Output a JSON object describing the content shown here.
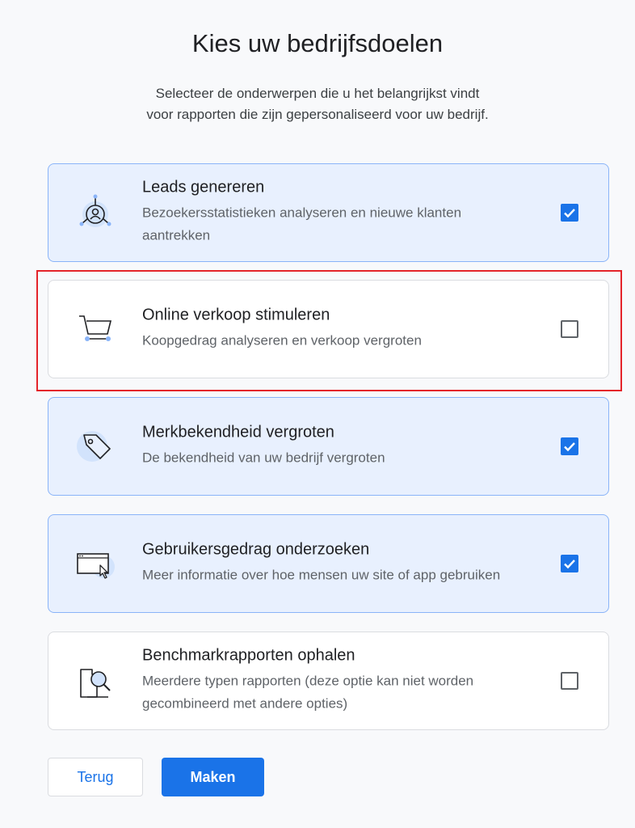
{
  "header": {
    "title": "Kies uw bedrijfsdoelen",
    "subtitle_line1": "Selecteer de onderwerpen die u het belangrijkst vindt",
    "subtitle_line2": "voor rapporten die zijn gepersonaliseerd voor uw bedrijf."
  },
  "options": [
    {
      "title": "Leads genereren",
      "description": "Bezoekersstatistieken analyseren en nieuwe klanten aantrekken",
      "checked": true,
      "icon": "person-network-icon"
    },
    {
      "title": "Online verkoop stimuleren",
      "description": "Koopgedrag analyseren en verkoop vergroten",
      "checked": false,
      "icon": "shopping-cart-icon"
    },
    {
      "title": "Merkbekendheid vergroten",
      "description": "De bekendheid van uw bedrijf vergroten",
      "checked": true,
      "icon": "tag-icon"
    },
    {
      "title": "Gebruikersgedrag onderzoeken",
      "description": "Meer informatie over hoe mensen uw site of app gebruiken",
      "checked": true,
      "icon": "browser-cursor-icon"
    },
    {
      "title": "Benchmarkrapporten ophalen",
      "description": "Meerdere typen rapporten (deze optie kan niet worden gecombineerd met andere opties)",
      "checked": false,
      "icon": "report-magnifier-icon"
    }
  ],
  "buttons": {
    "back_label": "Terug",
    "create_label": "Maken"
  },
  "colors": {
    "accent": "#1a73e8",
    "selected_bg": "#e8f0fe",
    "highlight": "#e4242a"
  }
}
